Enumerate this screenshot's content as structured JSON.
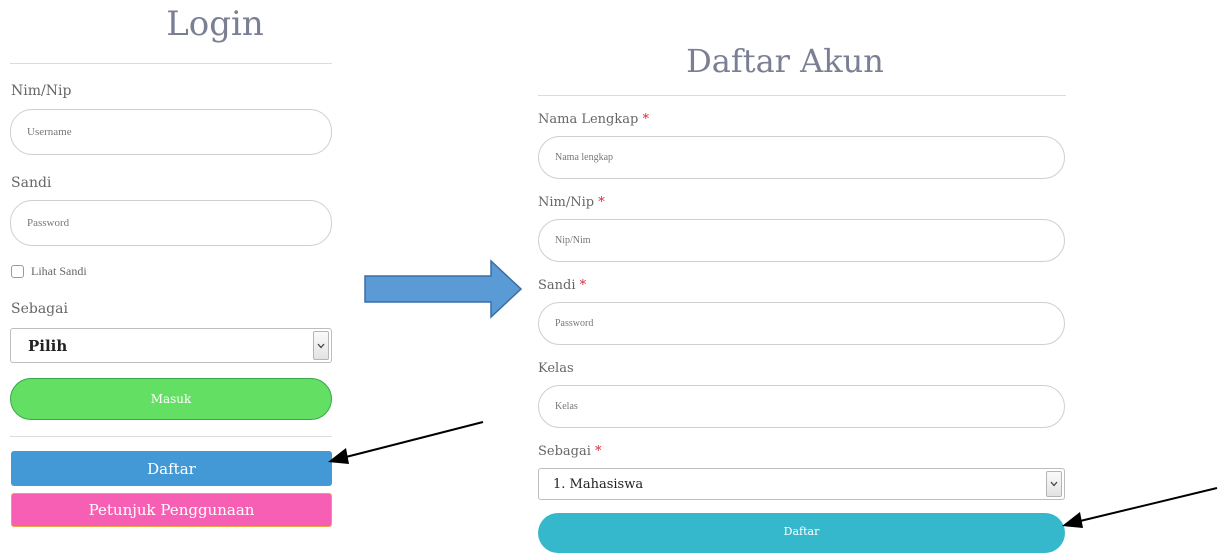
{
  "login": {
    "title": "Login",
    "nim_label": "Nim/Nip",
    "username_placeholder": "Username",
    "password_label": "Sandi",
    "password_placeholder": "Password",
    "show_password_label": "Lihat Sandi",
    "role_label": "Sebagai",
    "role_selected": "Pilih",
    "submit_label": "Masuk",
    "register_label": "Daftar",
    "guide_label": "Petunjuk Penggunaan"
  },
  "register": {
    "title": "Daftar Akun",
    "name_label": "Nama Lengkap",
    "name_placeholder": "Nama lengkap",
    "nim_label": "Nim/Nip",
    "nim_placeholder": "Nip/Nim",
    "password_label": "Sandi",
    "password_placeholder": "Password",
    "class_label": "Kelas",
    "class_placeholder": "Kelas",
    "role_label": "Sebagai",
    "role_selected": "1. Mahasiswa",
    "submit_label": "Daftar",
    "required_mark": "*"
  },
  "colors": {
    "masuk_button": "#63df63",
    "daftar_button": "#4299d6",
    "guide_button": "#f75fb4",
    "register_submit": "#36b8cc",
    "big_arrow": "#5b9bd5"
  },
  "icons": {
    "flow_arrow": "right-arrow-icon",
    "pointer_arrow": "pointer-arrow-icon",
    "select_arrow": "chevron-down-icon"
  }
}
